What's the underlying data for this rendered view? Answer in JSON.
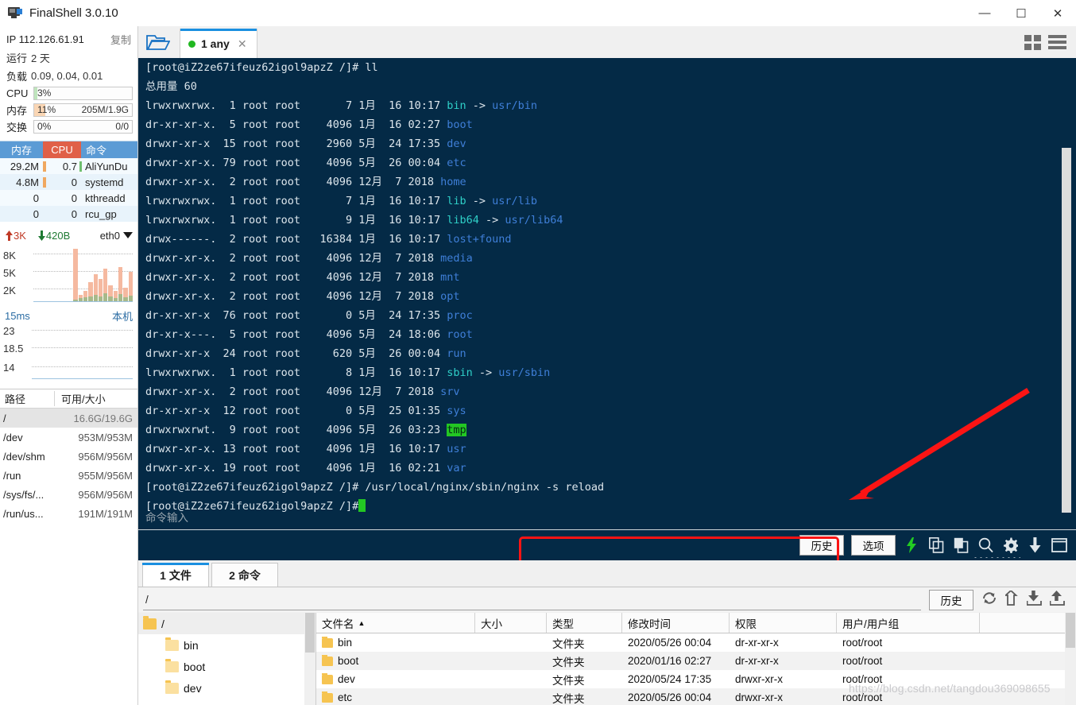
{
  "window": {
    "title": "FinalShell 3.0.10",
    "minimize": "—",
    "maximize": "☐",
    "close": "✕"
  },
  "sidebar": {
    "ip_label": "IP 112.126.61.91",
    "copy_label": "复制",
    "uptime_key": "运行",
    "uptime_value": "2 天",
    "load_key": "负载",
    "load_value": "0.09, 0.04, 0.01",
    "meters": [
      {
        "label": "CPU",
        "percent": "3%",
        "right": "",
        "fill_pct": 3,
        "color": "#bfe5bd"
      },
      {
        "label": "内存",
        "percent": "11%",
        "right": "205M/1.9G",
        "fill_pct": 11,
        "color": "#fad6b4"
      },
      {
        "label": "交换",
        "percent": "0%",
        "right": "0/0",
        "fill_pct": 0,
        "color": "#cfe8cd"
      }
    ],
    "process_table": {
      "headers": {
        "mem": "内存",
        "cpu": "CPU",
        "cmd": "命令"
      },
      "rows": [
        {
          "mem": "29.2M",
          "cpu": "0.7",
          "cmd": "AliYunDu"
        },
        {
          "mem": "4.8M",
          "cpu": "0",
          "cmd": "systemd"
        },
        {
          "mem": "0",
          "cpu": "0",
          "cmd": "kthreadd"
        },
        {
          "mem": "0",
          "cpu": "0",
          "cmd": "rcu_gp"
        }
      ]
    },
    "network": {
      "upload": "3K",
      "download": "420B",
      "interface": "eth0",
      "y_labels": [
        "8K",
        "5K",
        "2K"
      ],
      "latency_value": "15ms",
      "latency_host": "本机",
      "latency_y_labels": [
        "23",
        "18.5",
        "14"
      ]
    },
    "disk_table": {
      "headers": {
        "path": "路径",
        "size": "可用/大小"
      },
      "rows": [
        {
          "path": "/",
          "size": "16.6G/19.6G",
          "selected": true
        },
        {
          "path": "/dev",
          "size": "953M/953M",
          "selected": false
        },
        {
          "path": "/dev/shm",
          "size": "956M/956M",
          "selected": false
        },
        {
          "path": "/run",
          "size": "955M/956M",
          "selected": false
        },
        {
          "path": "/sys/fs/...",
          "size": "956M/956M",
          "selected": false
        },
        {
          "path": "/run/us...",
          "size": "191M/191M",
          "selected": false
        }
      ]
    }
  },
  "tabbar": {
    "folder_icon": "open-folder-icon",
    "tab_label": "1 any",
    "tab_close": "✕",
    "grid_icon": "grid-view-icon",
    "list_icon": "list-view-icon"
  },
  "terminal": {
    "prompt": "[root@iZ2ze67ifeuz62igol9apzZ /]#",
    "first_command": "ll",
    "total_line": "总用量 60",
    "entries": [
      {
        "perm": "lrwxrwxrwx.",
        "links": "1",
        "owner": "root",
        "group": "root",
        "size": "7",
        "month": "1月",
        "day": "16",
        "time": "10:17",
        "name": "bin",
        "link_target": "usr/bin",
        "color": "cyan"
      },
      {
        "perm": "dr-xr-xr-x.",
        "links": "5",
        "owner": "root",
        "group": "root",
        "size": "4096",
        "month": "1月",
        "day": "16",
        "time": "02:27",
        "name": "boot",
        "link_target": "",
        "color": "blue"
      },
      {
        "perm": "drwxr-xr-x",
        "links": "15",
        "owner": "root",
        "group": "root",
        "size": "2960",
        "month": "5月",
        "day": "24",
        "time": "17:35",
        "name": "dev",
        "link_target": "",
        "color": "blue"
      },
      {
        "perm": "drwxr-xr-x.",
        "links": "79",
        "owner": "root",
        "group": "root",
        "size": "4096",
        "month": "5月",
        "day": "26",
        "time": "00:04",
        "name": "etc",
        "link_target": "",
        "color": "blue"
      },
      {
        "perm": "drwxr-xr-x.",
        "links": "2",
        "owner": "root",
        "group": "root",
        "size": "4096",
        "month": "12月",
        "day": "7",
        "time": "2018",
        "name": "home",
        "link_target": "",
        "color": "blue"
      },
      {
        "perm": "lrwxrwxrwx.",
        "links": "1",
        "owner": "root",
        "group": "root",
        "size": "7",
        "month": "1月",
        "day": "16",
        "time": "10:17",
        "name": "lib",
        "link_target": "usr/lib",
        "color": "cyan"
      },
      {
        "perm": "lrwxrwxrwx.",
        "links": "1",
        "owner": "root",
        "group": "root",
        "size": "9",
        "month": "1月",
        "day": "16",
        "time": "10:17",
        "name": "lib64",
        "link_target": "usr/lib64",
        "color": "cyan"
      },
      {
        "perm": "drwx------.",
        "links": "2",
        "owner": "root",
        "group": "root",
        "size": "16384",
        "month": "1月",
        "day": "16",
        "time": "10:17",
        "name": "lost+found",
        "link_target": "",
        "color": "blue"
      },
      {
        "perm": "drwxr-xr-x.",
        "links": "2",
        "owner": "root",
        "group": "root",
        "size": "4096",
        "month": "12月",
        "day": "7",
        "time": "2018",
        "name": "media",
        "link_target": "",
        "color": "blue"
      },
      {
        "perm": "drwxr-xr-x.",
        "links": "2",
        "owner": "root",
        "group": "root",
        "size": "4096",
        "month": "12月",
        "day": "7",
        "time": "2018",
        "name": "mnt",
        "link_target": "",
        "color": "blue"
      },
      {
        "perm": "drwxr-xr-x.",
        "links": "2",
        "owner": "root",
        "group": "root",
        "size": "4096",
        "month": "12月",
        "day": "7",
        "time": "2018",
        "name": "opt",
        "link_target": "",
        "color": "blue"
      },
      {
        "perm": "dr-xr-xr-x",
        "links": "76",
        "owner": "root",
        "group": "root",
        "size": "0",
        "month": "5月",
        "day": "24",
        "time": "17:35",
        "name": "proc",
        "link_target": "",
        "color": "blue"
      },
      {
        "perm": "dr-xr-x---.",
        "links": "5",
        "owner": "root",
        "group": "root",
        "size": "4096",
        "month": "5月",
        "day": "24",
        "time": "18:06",
        "name": "root",
        "link_target": "",
        "color": "blue"
      },
      {
        "perm": "drwxr-xr-x",
        "links": "24",
        "owner": "root",
        "group": "root",
        "size": "620",
        "month": "5月",
        "day": "26",
        "time": "00:04",
        "name": "run",
        "link_target": "",
        "color": "blue"
      },
      {
        "perm": "lrwxrwxrwx.",
        "links": "1",
        "owner": "root",
        "group": "root",
        "size": "8",
        "month": "1月",
        "day": "16",
        "time": "10:17",
        "name": "sbin",
        "link_target": "usr/sbin",
        "color": "cyan"
      },
      {
        "perm": "drwxr-xr-x.",
        "links": "2",
        "owner": "root",
        "group": "root",
        "size": "4096",
        "month": "12月",
        "day": "7",
        "time": "2018",
        "name": "srv",
        "link_target": "",
        "color": "blue"
      },
      {
        "perm": "dr-xr-xr-x",
        "links": "12",
        "owner": "root",
        "group": "root",
        "size": "0",
        "month": "5月",
        "day": "25",
        "time": "01:35",
        "name": "sys",
        "link_target": "",
        "color": "blue"
      },
      {
        "perm": "drwxrwxrwt.",
        "links": "9",
        "owner": "root",
        "group": "root",
        "size": "4096",
        "month": "5月",
        "day": "26",
        "time": "03:23",
        "name": "tmp",
        "link_target": "",
        "color": "greenbg"
      },
      {
        "perm": "drwxr-xr-x.",
        "links": "13",
        "owner": "root",
        "group": "root",
        "size": "4096",
        "month": "1月",
        "day": "16",
        "time": "10:17",
        "name": "usr",
        "link_target": "",
        "color": "blue"
      },
      {
        "perm": "drwxr-xr-x.",
        "links": "19",
        "owner": "root",
        "group": "root",
        "size": "4096",
        "month": "1月",
        "day": "16",
        "time": "02:21",
        "name": "var",
        "link_target": "",
        "color": "blue"
      }
    ],
    "highlighted_command": "/usr/local/nginx/sbin/nginx -s reload",
    "input_placeholder": "命令输入",
    "toolbar": {
      "history_label": "历史",
      "options_label": "选项",
      "icons": [
        "lightning-icon",
        "copy-icon",
        "paste-icon",
        "search-icon",
        "gear-icon",
        "download-icon",
        "window-icon"
      ]
    }
  },
  "filemanager": {
    "tabs": [
      {
        "label": "1 文件",
        "active": true
      },
      {
        "label": "2 命令",
        "active": false
      }
    ],
    "path_value": "/",
    "history_label": "历史",
    "toolbar_icons": [
      "refresh-icon",
      "up-arrow-icon",
      "download-icon",
      "upload-icon"
    ],
    "tree": [
      {
        "label": "/",
        "level": 0
      },
      {
        "label": "bin",
        "level": 1
      },
      {
        "label": "boot",
        "level": 1
      },
      {
        "label": "dev",
        "level": 1
      }
    ],
    "columns": [
      "文件名",
      "大小",
      "类型",
      "修改时间",
      "权限",
      "用户/用户组"
    ],
    "sort_arrow": "▲",
    "rows": [
      {
        "name": "bin",
        "size": "",
        "type": "文件夹",
        "mtime": "2020/05/26 00:04",
        "perm": "dr-xr-xr-x",
        "owner": "root/root"
      },
      {
        "name": "boot",
        "size": "",
        "type": "文件夹",
        "mtime": "2020/01/16 02:27",
        "perm": "dr-xr-xr-x",
        "owner": "root/root"
      },
      {
        "name": "dev",
        "size": "",
        "type": "文件夹",
        "mtime": "2020/05/24 17:35",
        "perm": "drwxr-xr-x",
        "owner": "root/root"
      },
      {
        "name": "etc",
        "size": "",
        "type": "文件夹",
        "mtime": "2020/05/26 00:04",
        "perm": "drwxr-xr-x",
        "owner": "root/root"
      }
    ]
  },
  "annotations": {
    "watermark": "https://blog.csdn.net/tangdou369098655",
    "box_color": "#fb1414",
    "arrow_color": "#fb1414"
  }
}
